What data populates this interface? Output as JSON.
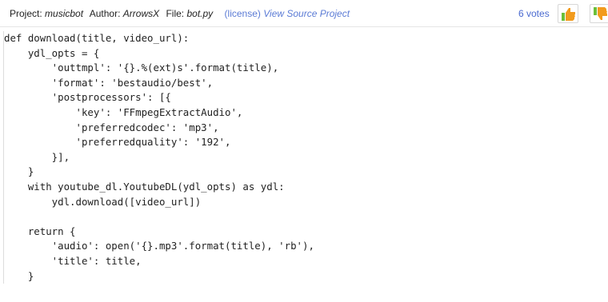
{
  "header": {
    "project_label": "Project:",
    "project_name": "musicbot",
    "author_label": "Author:",
    "author_name": "ArrowsX",
    "file_label": "File:",
    "file_name": "bot.py",
    "license_link": "(license)",
    "view_source_link": "View Source Project",
    "votes_text": "6 votes"
  },
  "icons": {
    "upvote": "thumbs-up-icon",
    "downvote": "thumbs-down-icon"
  },
  "colors": {
    "link": "#5b7bd5",
    "thumb_orange": "#f29b1d",
    "thumb_green": "#6cbf3a"
  },
  "code": {
    "lines": [
      "def download(title, video_url):",
      "    ydl_opts = {",
      "        'outtmpl': '{}.%(ext)s'.format(title),",
      "        'format': 'bestaudio/best',",
      "        'postprocessors': [{",
      "            'key': 'FFmpegExtractAudio',",
      "            'preferredcodec': 'mp3',",
      "            'preferredquality': '192',",
      "        }],",
      "    }",
      "    with youtube_dl.YoutubeDL(ydl_opts) as ydl:",
      "        ydl.download([video_url])",
      "",
      "    return {",
      "        'audio': open('{}.mp3'.format(title), 'rb'),",
      "        'title': title,",
      "    }"
    ]
  }
}
